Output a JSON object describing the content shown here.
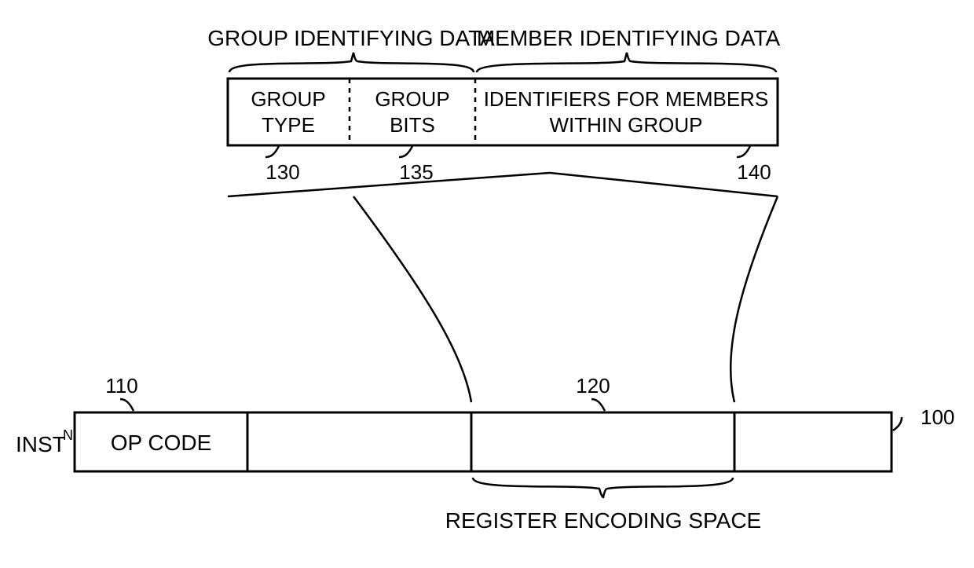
{
  "upper": {
    "group_identifying_label": "GROUP IDENTIFYING DATA",
    "member_identifying_label": "MEMBER IDENTIFYING DATA",
    "cells": {
      "group_type": {
        "line1": "GROUP",
        "line2": "TYPE",
        "ref": "130"
      },
      "group_bits": {
        "line1": "GROUP",
        "line2": "BITS",
        "ref": "135"
      },
      "members": {
        "line1": "IDENTIFIERS FOR MEMBERS",
        "line2": "WITHIN GROUP",
        "ref": "140"
      }
    }
  },
  "lower": {
    "instn_label": "INST",
    "instn_sup": "N",
    "op_code_label": "OP CODE",
    "register_encoding_label": "REGISTER ENCODING SPACE",
    "refs": {
      "op_code": "110",
      "reg_space": "120",
      "whole": "100"
    }
  }
}
